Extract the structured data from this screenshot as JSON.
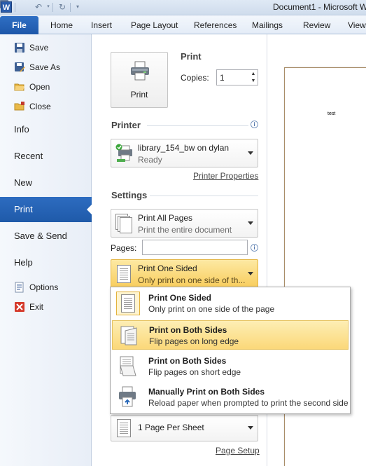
{
  "window": {
    "title": "Document1 - Microsoft W",
    "app_icon": "W"
  },
  "ribbon": {
    "file_tab": "File",
    "tabs": [
      "Home",
      "Insert",
      "Page Layout",
      "References",
      "Mailings",
      "Review",
      "View"
    ]
  },
  "nav": {
    "save": "Save",
    "save_as": "Save As",
    "open": "Open",
    "close": "Close",
    "info": "Info",
    "recent": "Recent",
    "new": "New",
    "print": "Print",
    "save_send": "Save & Send",
    "help": "Help",
    "options": "Options",
    "exit": "Exit"
  },
  "print": {
    "heading": "Print",
    "button_label": "Print",
    "copies_label": "Copies:",
    "copies_value": "1"
  },
  "printer": {
    "heading": "Printer",
    "name": "library_154_bw on dylan",
    "status": "Ready",
    "properties_link": "Printer Properties"
  },
  "settings": {
    "heading": "Settings",
    "pages_range": {
      "title": "Print All Pages",
      "subtitle": "Print the entire document"
    },
    "pages_label": "Pages:",
    "pages_value": "",
    "sided": {
      "title": "Print One Sided",
      "subtitle": "Only print on one side of th..."
    },
    "per_sheet": {
      "title": "1 Page Per Sheet"
    },
    "page_setup_link": "Page Setup"
  },
  "sided_menu": {
    "items": [
      {
        "title": "Print One Sided",
        "subtitle": "Only print on one side of the page"
      },
      {
        "title": "Print on Both Sides",
        "subtitle": "Flip pages on long edge"
      },
      {
        "title": "Print on Both Sides",
        "subtitle": "Flip pages on short edge"
      },
      {
        "title": "Manually Print on Both Sides",
        "subtitle": "Reload paper when prompted to print the second side"
      }
    ],
    "highlighted_index": 1
  },
  "preview": {
    "text": "test"
  },
  "colors": {
    "accent": "#2b6ab9",
    "highlight": "#fbd879",
    "file_tab": "#1d57a9"
  }
}
